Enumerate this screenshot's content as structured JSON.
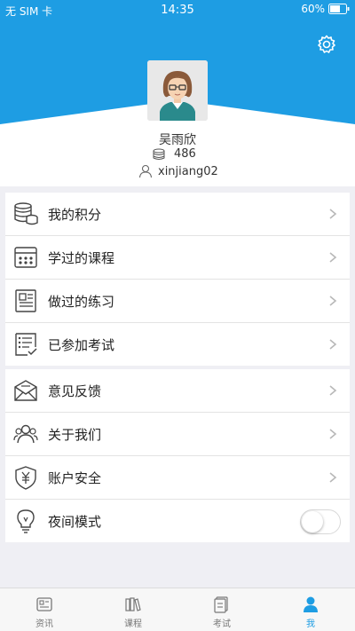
{
  "status_bar": {
    "carrier": "无 SIM 卡",
    "time": "14:35",
    "battery": "60%"
  },
  "profile": {
    "name": "吴雨欣",
    "points": "486",
    "account": "xinjiang02"
  },
  "menu_group1": [
    {
      "label": "我的积分",
      "icon": "coins-icon"
    },
    {
      "label": "学过的课程",
      "icon": "calendar-icon"
    },
    {
      "label": "做过的练习",
      "icon": "document-icon"
    },
    {
      "label": "已参加考试",
      "icon": "checklist-icon"
    }
  ],
  "menu_group2": [
    {
      "label": "意见反馈",
      "icon": "mail-icon"
    },
    {
      "label": "关于我们",
      "icon": "users-icon"
    },
    {
      "label": "账户安全",
      "icon": "shield-yen-icon"
    },
    {
      "label": "夜间模式",
      "icon": "bulb-icon",
      "toggle": false
    }
  ],
  "tabs": [
    {
      "label": "资讯",
      "icon": "news-icon",
      "active": false
    },
    {
      "label": "课程",
      "icon": "books-icon",
      "active": false
    },
    {
      "label": "考试",
      "icon": "exam-icon",
      "active": false
    },
    {
      "label": "我",
      "icon": "person-icon",
      "active": true
    }
  ],
  "colors": {
    "primary": "#1e9de3",
    "background": "#efeff4"
  }
}
